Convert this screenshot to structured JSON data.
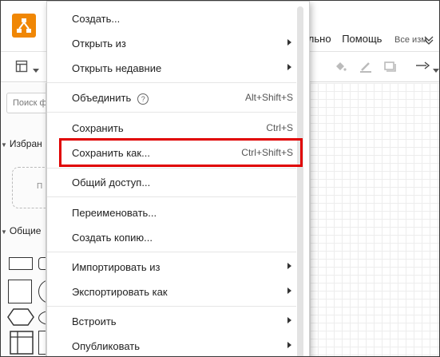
{
  "header": {
    "menus": [
      "ельно",
      "Помощь"
    ],
    "status_text": "Все изм"
  },
  "sidebar": {
    "search_placeholder": "Поиск ф",
    "favorites_title": "Избран",
    "favorites_hint": "П",
    "general_title": "Общие"
  },
  "menu": {
    "items": [
      {
        "label": "Создать...",
        "shortcut": "",
        "submenu": false
      },
      {
        "label": "Открыть из",
        "shortcut": "",
        "submenu": true
      },
      {
        "label": "Открыть недавние",
        "shortcut": "",
        "submenu": true
      },
      {
        "label": "Объединить",
        "shortcut": "Alt+Shift+S",
        "submenu": false,
        "help": true
      },
      {
        "label": "Сохранить",
        "shortcut": "Ctrl+S",
        "submenu": false
      },
      {
        "label": "Сохранить как...",
        "shortcut": "Ctrl+Shift+S",
        "submenu": false,
        "highlighted": true
      },
      {
        "label": "Общий доступ...",
        "shortcut": "",
        "submenu": false
      },
      {
        "label": "Переименовать...",
        "shortcut": "",
        "submenu": false
      },
      {
        "label": "Создать копию...",
        "shortcut": "",
        "submenu": false
      },
      {
        "label": "Импортировать из",
        "shortcut": "",
        "submenu": true
      },
      {
        "label": "Экспортировать как",
        "shortcut": "",
        "submenu": true
      },
      {
        "label": "Встроить",
        "shortcut": "",
        "submenu": true
      },
      {
        "label": "Опубликовать",
        "shortcut": "",
        "submenu": true
      }
    ],
    "help_glyph": "?"
  },
  "colors": {
    "brand": "#f08705",
    "highlight": "#e00000"
  }
}
